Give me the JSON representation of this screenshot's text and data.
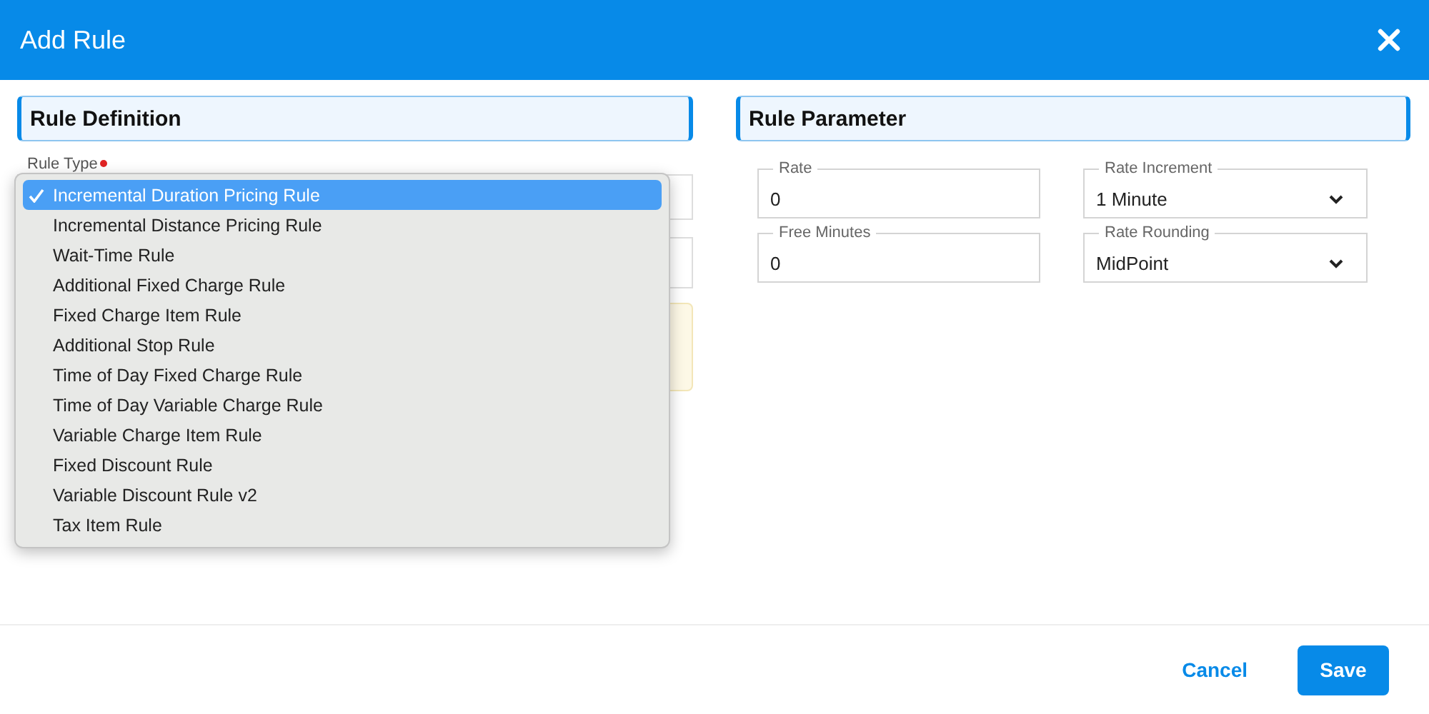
{
  "dialog": {
    "title": "Add Rule"
  },
  "rule_definition": {
    "heading": "Rule Definition",
    "rule_type": {
      "label": "Rule Type",
      "required": true,
      "options": [
        {
          "label": "Incremental Duration Pricing Rule",
          "selected": true
        },
        {
          "label": "Incremental Distance Pricing Rule",
          "selected": false
        },
        {
          "label": "Wait-Time Rule",
          "selected": false
        },
        {
          "label": "Additional Fixed Charge Rule",
          "selected": false
        },
        {
          "label": "Fixed Charge Item Rule",
          "selected": false
        },
        {
          "label": "Additional Stop Rule",
          "selected": false
        },
        {
          "label": "Time of Day Fixed Charge Rule",
          "selected": false
        },
        {
          "label": "Time of Day Variable Charge Rule",
          "selected": false
        },
        {
          "label": "Variable Charge Item Rule",
          "selected": false
        },
        {
          "label": "Fixed Discount Rule",
          "selected": false
        },
        {
          "label": "Variable Discount Rule v2",
          "selected": false
        },
        {
          "label": "Tax Item Rule",
          "selected": false
        }
      ]
    }
  },
  "rule_parameter": {
    "heading": "Rule Parameter",
    "fields": [
      {
        "kind": "input",
        "label": "Rate",
        "value": "0"
      },
      {
        "kind": "select",
        "label": "Rate Increment",
        "value": "1 Minute"
      },
      {
        "kind": "input",
        "label": "Free Minutes",
        "value": "0"
      },
      {
        "kind": "select",
        "label": "Rate Rounding",
        "value": "MidPoint"
      }
    ]
  },
  "buttons": [
    {
      "kind": "text",
      "label": "Cancel"
    },
    {
      "kind": "primary",
      "label": "Save"
    }
  ]
}
